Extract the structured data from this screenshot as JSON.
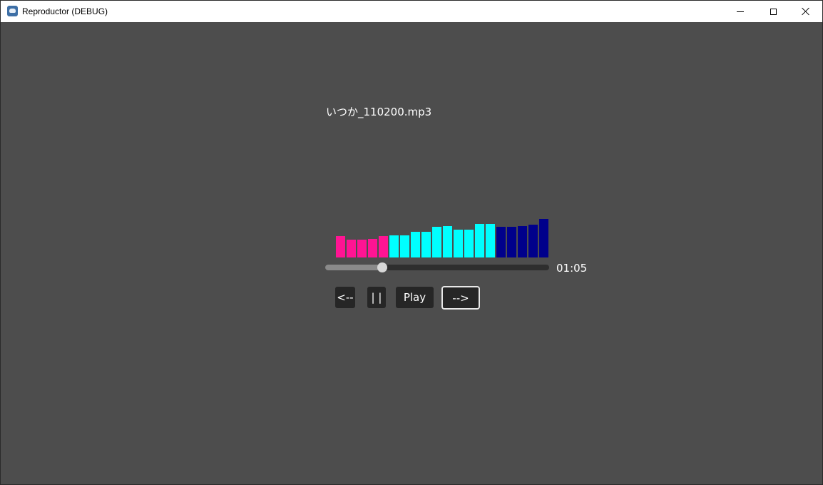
{
  "window": {
    "title": "Reproductor (DEBUG)",
    "controls": {
      "minimize": "minimize-icon",
      "maximize": "maximize-icon",
      "close": "close-icon"
    }
  },
  "player": {
    "track_title": "いつか_110200.mp3",
    "time": "01:05",
    "progress": 0.25,
    "buttons": {
      "prev": "<--",
      "pause": "| |",
      "play": "Play",
      "next": "-->"
    }
  },
  "visualizer": {
    "bars": [
      {
        "level": 0.55,
        "color": "#ff1493"
      },
      {
        "level": 0.46,
        "color": "#ff1493"
      },
      {
        "level": 0.46,
        "color": "#ff1493"
      },
      {
        "level": 0.48,
        "color": "#ff1493"
      },
      {
        "level": 0.55,
        "color": "#ff1493"
      },
      {
        "level": 0.56,
        "color": "#00ffff"
      },
      {
        "level": 0.56,
        "color": "#00ffff"
      },
      {
        "level": 0.65,
        "color": "#00ffff"
      },
      {
        "level": 0.66,
        "color": "#00ffff"
      },
      {
        "level": 0.78,
        "color": "#00ffff"
      },
      {
        "level": 0.8,
        "color": "#00ffff"
      },
      {
        "level": 0.7,
        "color": "#00ffff"
      },
      {
        "level": 0.7,
        "color": "#00ffff"
      },
      {
        "level": 0.86,
        "color": "#00ffff"
      },
      {
        "level": 0.85,
        "color": "#00ffff"
      },
      {
        "level": 0.78,
        "color": "#00008b"
      },
      {
        "level": 0.78,
        "color": "#00008b"
      },
      {
        "level": 0.8,
        "color": "#00008b"
      },
      {
        "level": 0.83,
        "color": "#00008b"
      },
      {
        "level": 0.98,
        "color": "#00008b"
      }
    ]
  }
}
